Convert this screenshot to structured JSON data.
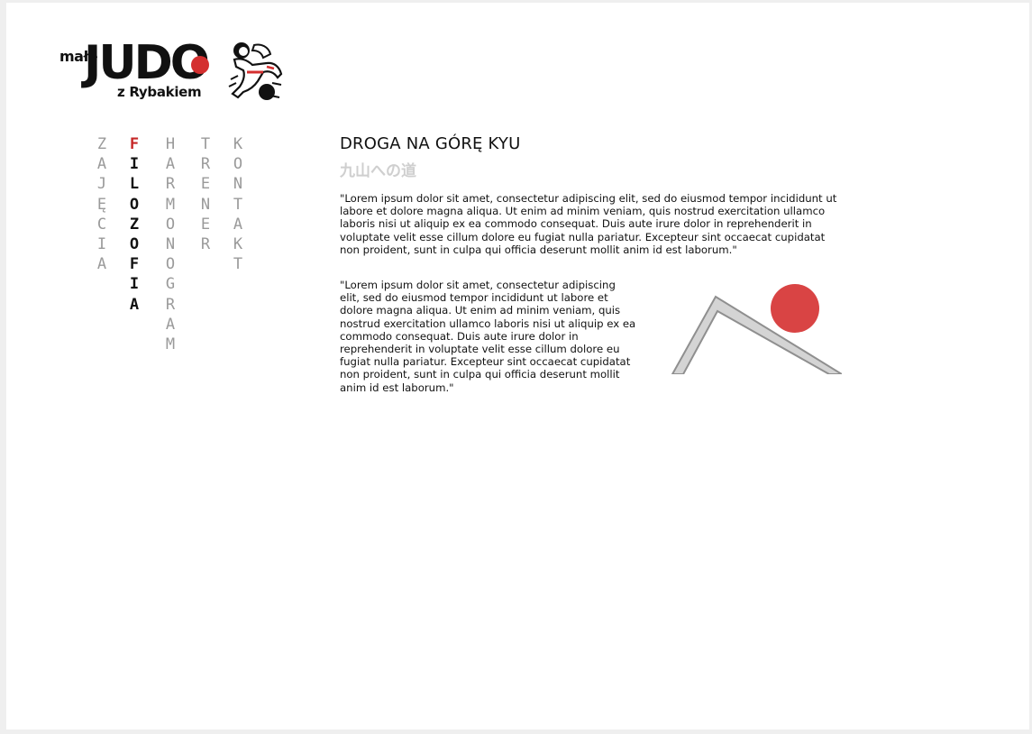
{
  "logo": {
    "small_text": "małe",
    "main_text": "JUDO",
    "sub_text": "z Rybakiem"
  },
  "nav": [
    {
      "label": "ZAJĘCIA",
      "active": false
    },
    {
      "label": "FILOZOFIA",
      "active": true
    },
    {
      "label": "HARMONOGRAM",
      "active": false
    },
    {
      "label": "TRENER",
      "active": false
    },
    {
      "label": "KONTAKT",
      "active": false
    }
  ],
  "article": {
    "title": "DROGA NA GÓRĘ KYU",
    "subtitle": "九山への道",
    "paragraph_1": "\"Lorem ipsum dolor sit amet, consectetur adipiscing elit, sed do eiusmod tempor incididunt ut labore et dolore magna aliqua. Ut enim ad minim veniam, quis nostrud exercitation ullamco laboris nisi ut aliquip ex ea commodo consequat. Duis aute irure dolor in reprehenderit in voluptate velit esse cillum dolore eu fugiat nulla pariatur. Excepteur sint occaecat cupidatat non proident, sunt in culpa qui officia deserunt mollit anim id est laborum.\"",
    "paragraph_2": "\"Lorem ipsum dolor sit amet, consectetur adipiscing elit, sed do eiusmod tempor incididunt ut labore et dolore magna aliqua. Ut enim ad minim veniam, quis nostrud exercitation ullamco laboris nisi ut aliquip ex ea commodo consequat. Duis aute irure dolor in reprehenderit in voluptate velit esse cillum dolore eu fugiat nulla pariatur. Excepteur sint occaecat cupidatat non proident, sunt in culpa qui officia deserunt mollit anim id est laborum.\""
  },
  "colors": {
    "accent_red": "#d42f2f",
    "nav_inactive": "#9a9a9a",
    "subtitle_gray": "#cfcfcf"
  }
}
